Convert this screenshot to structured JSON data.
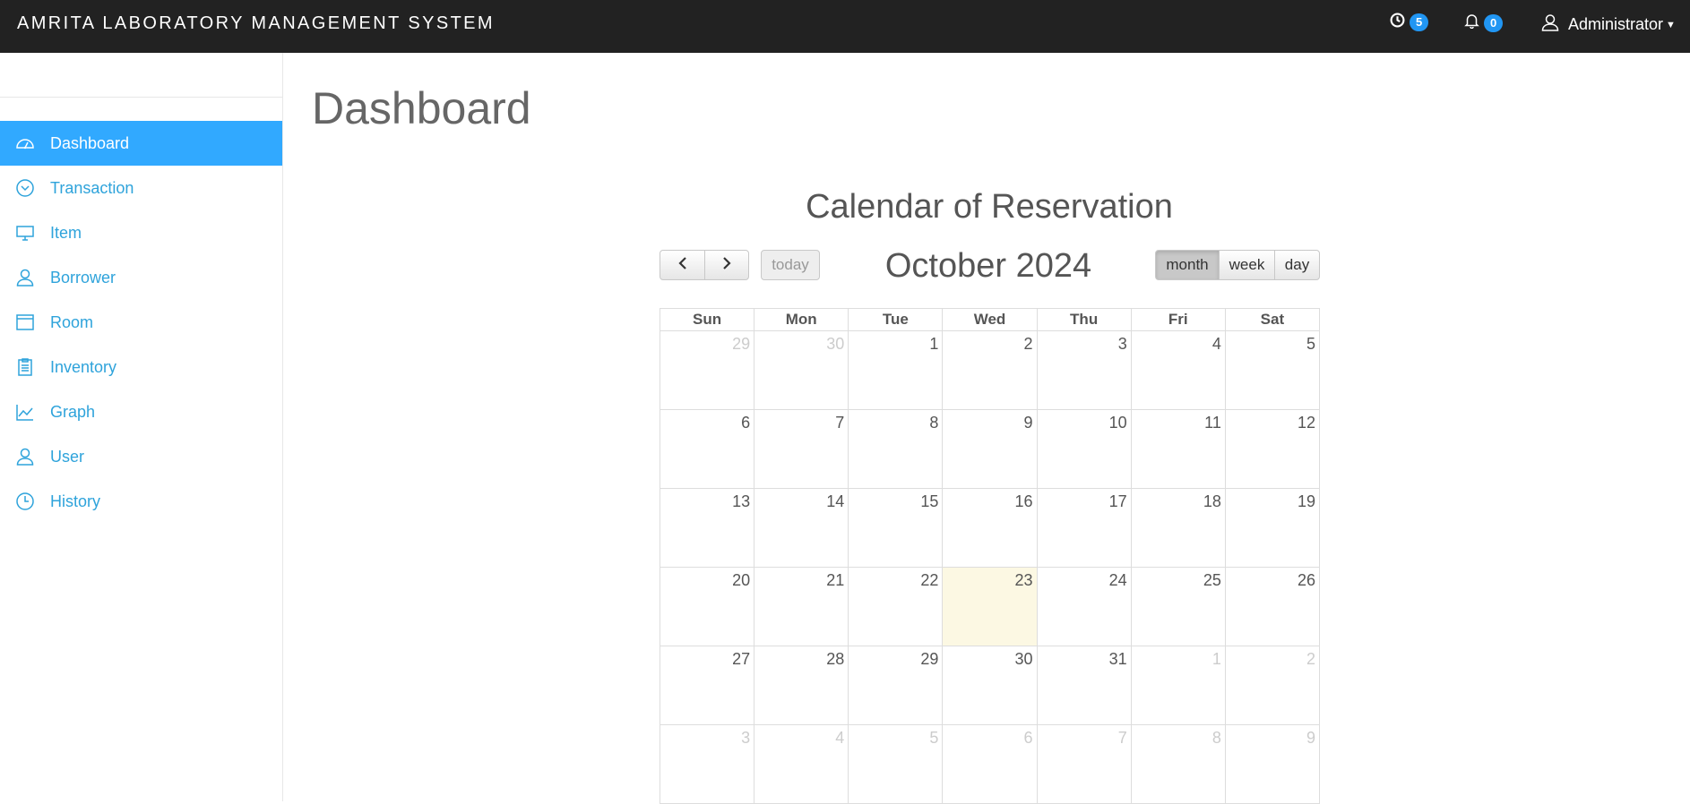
{
  "app": {
    "title": "AMRITA LABORATORY MANAGEMENT SYSTEM",
    "clock_badge": "5",
    "bell_badge": "0",
    "user_label": "Administrator",
    "icons": {
      "clock": "clock-icon",
      "bell": "bell-icon",
      "user": "user-icon"
    }
  },
  "sidebar": {
    "items": [
      {
        "label": "Dashboard",
        "icon": "dashboard-icon",
        "active": true
      },
      {
        "label": "Transaction",
        "icon": "chevron-circle-icon"
      },
      {
        "label": "Item",
        "icon": "monitor-icon"
      },
      {
        "label": "Borrower",
        "icon": "user-icon"
      },
      {
        "label": "Room",
        "icon": "window-icon"
      },
      {
        "label": "Inventory",
        "icon": "clipboard-icon"
      },
      {
        "label": "Graph",
        "icon": "chart-icon"
      },
      {
        "label": "User",
        "icon": "user-icon"
      },
      {
        "label": "History",
        "icon": "clock-icon"
      }
    ]
  },
  "main": {
    "page_title": "Dashboard",
    "calendar": {
      "title": "Calendar of Reservation",
      "month_title": "October 2024",
      "prev_icon": "chevron-left-icon",
      "next_icon": "chevron-right-icon",
      "today_label": "today",
      "views": [
        "month",
        "week",
        "day"
      ],
      "active_view": "month",
      "weekdays": [
        "Sun",
        "Mon",
        "Tue",
        "Wed",
        "Thu",
        "Fri",
        "Sat"
      ],
      "weeks": [
        [
          {
            "d": "29",
            "other": true
          },
          {
            "d": "30",
            "other": true
          },
          {
            "d": "1"
          },
          {
            "d": "2"
          },
          {
            "d": "3"
          },
          {
            "d": "4"
          },
          {
            "d": "5"
          }
        ],
        [
          {
            "d": "6"
          },
          {
            "d": "7"
          },
          {
            "d": "8"
          },
          {
            "d": "9"
          },
          {
            "d": "10"
          },
          {
            "d": "11"
          },
          {
            "d": "12"
          }
        ],
        [
          {
            "d": "13"
          },
          {
            "d": "14"
          },
          {
            "d": "15"
          },
          {
            "d": "16"
          },
          {
            "d": "17"
          },
          {
            "d": "18"
          },
          {
            "d": "19"
          }
        ],
        [
          {
            "d": "20"
          },
          {
            "d": "21"
          },
          {
            "d": "22"
          },
          {
            "d": "23",
            "today": true
          },
          {
            "d": "24"
          },
          {
            "d": "25"
          },
          {
            "d": "26"
          }
        ],
        [
          {
            "d": "27"
          },
          {
            "d": "28"
          },
          {
            "d": "29"
          },
          {
            "d": "30"
          },
          {
            "d": "31"
          },
          {
            "d": "1",
            "other": true
          },
          {
            "d": "2",
            "other": true
          }
        ],
        [
          {
            "d": "3",
            "other": true
          },
          {
            "d": "4",
            "other": true
          },
          {
            "d": "5",
            "other": true
          },
          {
            "d": "6",
            "other": true
          },
          {
            "d": "7",
            "other": true
          },
          {
            "d": "8",
            "other": true
          },
          {
            "d": "9",
            "other": true
          }
        ]
      ]
    }
  }
}
